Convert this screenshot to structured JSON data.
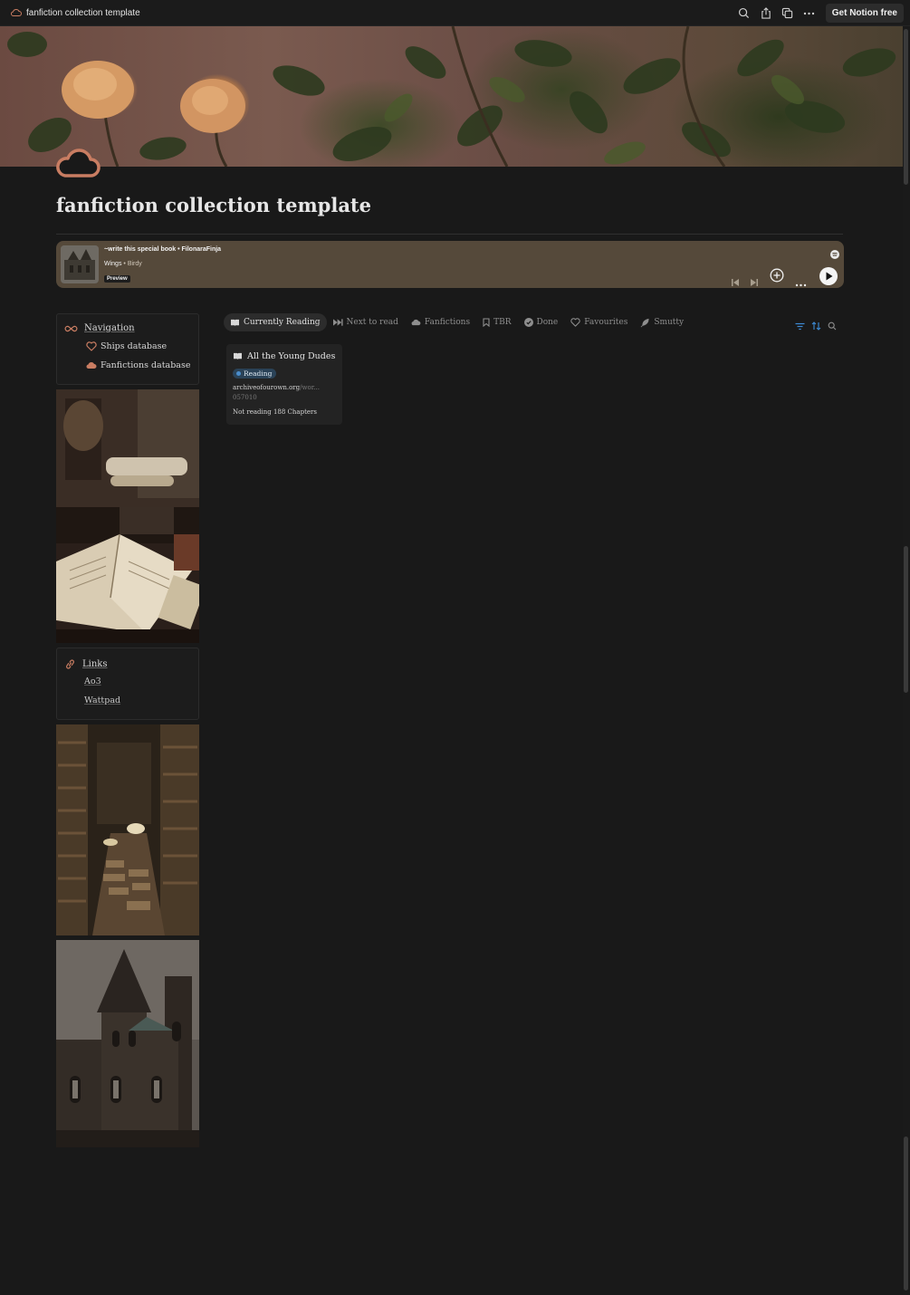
{
  "topbar": {
    "title": "fanfiction collection template",
    "get_notion_label": "Get Notion free",
    "icons": [
      "cloud-icon",
      "search-icon",
      "share-icon",
      "duplicate-icon",
      "more-icon"
    ]
  },
  "page": {
    "title": "fanfiction collection template",
    "icon": "cloud-icon"
  },
  "player": {
    "playlist": "~write this special book • FilonaraFinja",
    "song": "Wings",
    "artist": "Birdy",
    "badge": "Preview"
  },
  "navigation": {
    "heading": "Navigation",
    "items": [
      {
        "label": "Ships database",
        "icon": "heart-icon"
      },
      {
        "label": "Fanfictions database",
        "icon": "cloud-icon"
      }
    ]
  },
  "links": {
    "heading": "Links",
    "items": [
      "Ao3",
      "Wattpad"
    ]
  },
  "tabs": [
    {
      "label": "Currently Reading",
      "icon": "book-icon",
      "active": true
    },
    {
      "label": "Next to read",
      "icon": "skip-icon",
      "active": false
    },
    {
      "label": "Fanfictions",
      "icon": "cloud-icon",
      "active": false
    },
    {
      "label": "TBR",
      "icon": "bookmark-icon",
      "active": false
    },
    {
      "label": "Done",
      "icon": "check-circle-icon",
      "active": false
    },
    {
      "label": "Favourites",
      "icon": "heart-icon",
      "active": false
    },
    {
      "label": "Smutty",
      "icon": "feather-icon",
      "active": false
    }
  ],
  "card": {
    "title": "All the Young Dudes",
    "status": "Reading",
    "url_host": "archiveofourown.org",
    "url_path": "/wor...",
    "url_tail": "057010",
    "footer": "Not reading 188 Chapters"
  },
  "colors": {
    "background": "#191919",
    "accent": "#c97d62",
    "status_blue": "#2a4257",
    "player_bg": "#55493a"
  }
}
